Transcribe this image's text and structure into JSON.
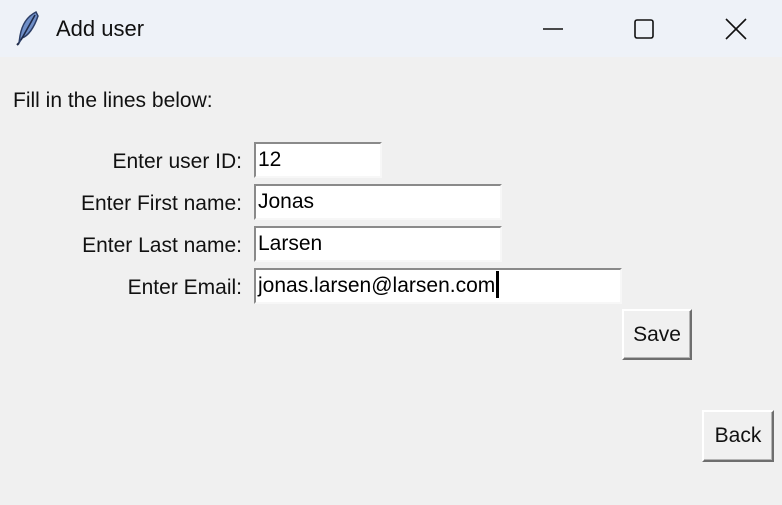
{
  "window": {
    "title": "Add user",
    "controls": {
      "minimize": "minimize-icon",
      "maximize": "maximize-icon",
      "close": "close-icon"
    },
    "app_icon": "feather-icon"
  },
  "form": {
    "intro": "Fill in the lines below:",
    "fields": [
      {
        "label": "Enter user ID:",
        "value": "12"
      },
      {
        "label": "Enter First name:",
        "value": "Jonas"
      },
      {
        "label": "Enter Last name:",
        "value": "Larsen"
      },
      {
        "label": "Enter Email:",
        "value": "jonas.larsen@larsen.com"
      }
    ],
    "save_label": "Save",
    "back_label": "Back"
  },
  "colors": {
    "window_bg": "#f0f0f0",
    "titlebar_bg": "#eef2f8",
    "feather_fill": "#6f8fc8"
  }
}
